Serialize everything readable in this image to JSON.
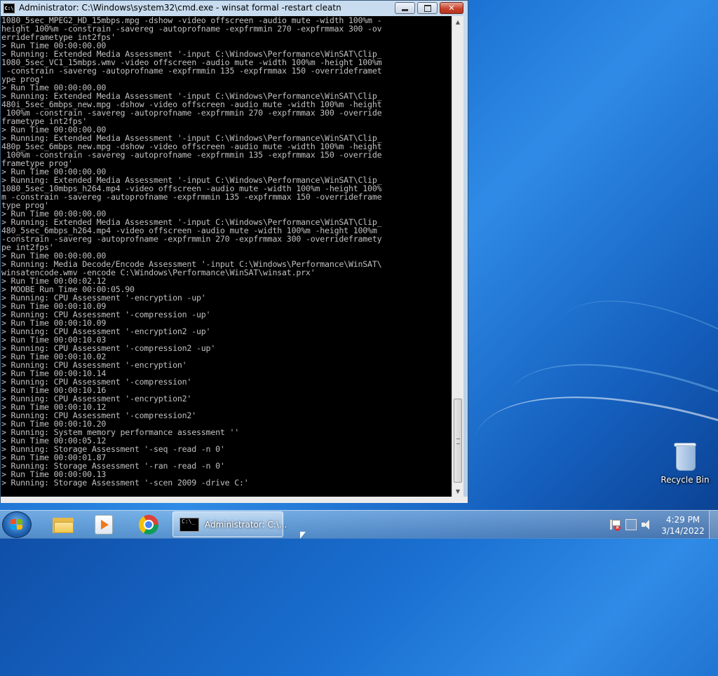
{
  "window": {
    "title": "Administrator: C:\\Windows\\system32\\cmd.exe - winsat  formal -restart cleatn",
    "icon_label": "C:\\",
    "buttons": {
      "minimize": "minimize-icon",
      "maximize": "maximize-icon",
      "close": "close-icon"
    }
  },
  "console": {
    "lines": [
      "1080_5sec_MPEG2_HD_15mbps.mpg -dshow -video offscreen -audio mute -width 100%m -",
      "height 100%m -constrain -savereg -autoprofname -expfrmmin 270 -expfrmmax 300 -ov",
      "errideframetype int2fps'",
      "> Run Time 00:00:00.00",
      "> Running: Extended Media Assessment '-input C:\\Windows\\Performance\\WinSAT\\Clip_",
      "1080_5sec_VC1_15mbps.wmv -video offscreen -audio mute -width 100%m -height 100%m",
      " -constrain -savereg -autoprofname -expfrmmin 135 -expfrmmax 150 -overrideframet",
      "ype prog'",
      "> Run Time 00:00:00.00",
      "> Running: Extended Media Assessment '-input C:\\Windows\\Performance\\WinSAT\\Clip_",
      "480i_5sec_6mbps_new.mpg -dshow -video offscreen -audio mute -width 100%m -height",
      " 100%m -constrain -savereg -autoprofname -expfrmmin 270 -expfrmmax 300 -override",
      "frametype int2fps'",
      "> Run Time 00:00:00.00",
      "> Running: Extended Media Assessment '-input C:\\Windows\\Performance\\WinSAT\\Clip_",
      "480p_5sec_6mbps_new.mpg -dshow -video offscreen -audio mute -width 100%m -height",
      " 100%m -constrain -savereg -autoprofname -expfrmmin 135 -expfrmmax 150 -override",
      "frametype prog'",
      "> Run Time 00:00:00.00",
      "> Running: Extended Media Assessment '-input C:\\Windows\\Performance\\WinSAT\\Clip_",
      "1080_5sec_10mbps_h264.mp4 -video offscreen -audio mute -width 100%m -height 100%",
      "m -constrain -savereg -autoprofname -expfrmmin 135 -expfrmmax 150 -overrideframe",
      "type prog'",
      "> Run Time 00:00:00.00",
      "> Running: Extended Media Assessment '-input C:\\Windows\\Performance\\WinSAT\\Clip_",
      "480_5sec_6mbps_h264.mp4 -video offscreen -audio mute -width 100%m -height 100%m",
      "-constrain -savereg -autoprofname -expfrmmin 270 -expfrmmax 300 -overrideframety",
      "pe int2fps'",
      "> Run Time 00:00:00.00",
      "> Running: Media Decode/Encode Assessment '-input C:\\Windows\\Performance\\WinSAT\\",
      "winsatencode.wmv -encode C:\\Windows\\Performance\\WinSAT\\winsat.prx'",
      "> Run Time 00:00:02.12",
      "> MOOBE Run Time 00:00:05.90",
      "> Running: CPU Assessment '-encryption -up'",
      "> Run Time 00:00:10.09",
      "> Running: CPU Assessment '-compression -up'",
      "> Run Time 00:00:10.09",
      "> Running: CPU Assessment '-encryption2 -up'",
      "> Run Time 00:00:10.03",
      "> Running: CPU Assessment '-compression2 -up'",
      "> Run Time 00:00:10.02",
      "> Running: CPU Assessment '-encryption'",
      "> Run Time 00:00:10.14",
      "> Running: CPU Assessment '-compression'",
      "> Run Time 00:00:10.16",
      "> Running: CPU Assessment '-encryption2'",
      "> Run Time 00:00:10.12",
      "> Running: CPU Assessment '-compression2'",
      "> Run Time 00:00:10.20",
      "> Running: System memory performance assessment ''",
      "> Run Time 00:00:05.12",
      "> Running: Storage Assessment '-seq -read -n 0'",
      "> Run Time 00:00:01.87",
      "> Running: Storage Assessment '-ran -read -n 0'",
      "> Run Time 00:00:00.13",
      "> Running: Storage Assessment '-scen 2009 -drive C:'"
    ]
  },
  "desktop": {
    "recycle_bin_label": "Recycle Bin"
  },
  "taskbar": {
    "start_icon": "windows-start-icon",
    "pinned": [
      {
        "name": "explorer",
        "icon": "folder-icon"
      },
      {
        "name": "media-player",
        "icon": "media-player-icon"
      },
      {
        "name": "chrome",
        "icon": "chrome-icon"
      }
    ],
    "active_task_label": "Administrator: C:\\...",
    "active_task_icon_text": "C:\\_",
    "clock_time": "4:29 PM",
    "clock_date": "3/14/2022"
  },
  "colors": {
    "console_bg": "#000000",
    "console_fg": "#c0c0c0",
    "desktop_accent": "#1a6fd0"
  }
}
